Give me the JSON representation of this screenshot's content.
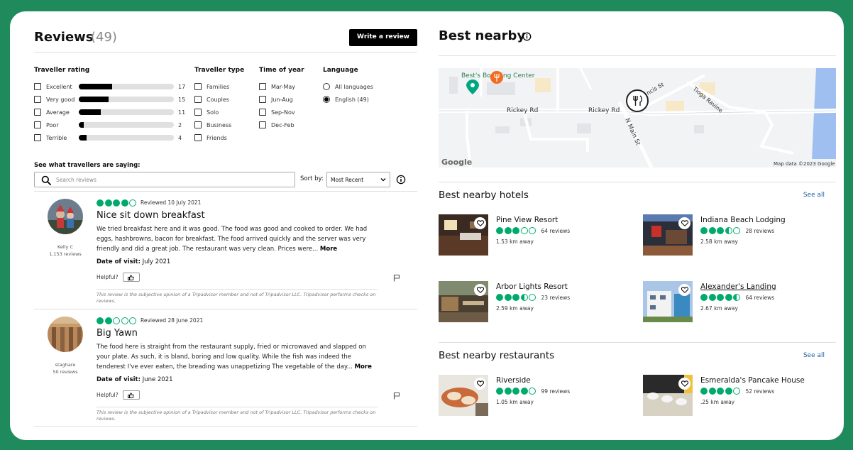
{
  "reviews_header": {
    "title": "Reviews",
    "count": "(49)",
    "write_button": "Write a review"
  },
  "filters": {
    "rating": {
      "heading": "Traveller rating",
      "items": [
        {
          "label": "Excellent",
          "count": "17",
          "fraction": 0.35
        },
        {
          "label": "Very good",
          "count": "15",
          "fraction": 0.31
        },
        {
          "label": "Average",
          "count": "11",
          "fraction": 0.23
        },
        {
          "label": "Poor",
          "count": "2",
          "fraction": 0.05
        },
        {
          "label": "Terrible",
          "count": "4",
          "fraction": 0.08
        }
      ]
    },
    "type": {
      "heading": "Traveller type",
      "items": [
        "Families",
        "Couples",
        "Solo",
        "Business",
        "Friends"
      ]
    },
    "time": {
      "heading": "Time of year",
      "items": [
        "Mar-May",
        "Jun-Aug",
        "Sep-Nov",
        "Dec-Feb"
      ]
    },
    "language": {
      "heading": "Language",
      "items": [
        "All languages",
        "English (49)"
      ],
      "selected": 1
    }
  },
  "search": {
    "heading": "See what travellers are saying:",
    "placeholder": "Search reviews",
    "sort_label": "Sort by:",
    "sort_value": "Most Recent"
  },
  "reviews": [
    {
      "user": "Kelly C",
      "user_reviews": "1,153 reviews",
      "rating": 4,
      "reviewed": "Reviewed 10 July 2021",
      "title": "Nice sit down breakfast",
      "body": "We tried breakfast here and it was good. The food was good and cooked to order. We had eggs, hashbrowns, bacon for breakfast. The food arrived quickly and the server was very friendly and did a great job. The restaurant was very clean. Prices were...",
      "more": "More",
      "visit_label": "Date of visit:",
      "visit_date": "July 2021",
      "helpful": "Helpful?",
      "disclaimer": "This review is the subjective opinion of a Tripadvisor member and not of Tripadvisor LLC. Tripadvisor performs checks on reviews."
    },
    {
      "user": "staghare",
      "user_reviews": "50 reviews",
      "rating": 2,
      "reviewed": "Reviewed 28 June 2021",
      "title": "Big Yawn",
      "body": "The food here is straight from the restaurant supply, fried or microwaved and slapped on your plate. As such, it is bland, boring and low quality. While the fish was indeed the tenderest I've ever eaten, the breading was unappetizing The vegetable of the day...",
      "more": "More",
      "visit_label": "Date of visit:",
      "visit_date": "June 2021",
      "helpful": "Helpful?",
      "disclaimer": "This review is the subjective opinion of a Tripadvisor member and not of Tripadvisor LLC. Tripadvisor performs checks on reviews."
    }
  ],
  "nearby": {
    "title": "Best nearby",
    "map": {
      "place": "Best's Boarding Center",
      "roads": [
        "Rickey Rd",
        "Rickey Rd",
        "N Main St",
        "Tioga Ravine",
        "ncis St"
      ],
      "logo": "Google",
      "attribution": "Map data ©2023 Google"
    },
    "hotels": {
      "title": "Best nearby hotels",
      "see_all": "See all",
      "items": [
        {
          "name": "Pine View Resort",
          "rating": 3,
          "reviews": "64 reviews",
          "distance": "1.53 km away"
        },
        {
          "name": "Indiana Beach Lodging",
          "rating": 3.5,
          "reviews": "28 reviews",
          "distance": "2.58 km away"
        },
        {
          "name": "Arbor Lights Resort",
          "rating": 3.5,
          "reviews": "23 reviews",
          "distance": "2.59 km away"
        },
        {
          "name": "Alexander's Landing",
          "rating": 4.5,
          "reviews": "64 reviews",
          "distance": "2.67 km away"
        }
      ]
    },
    "restaurants": {
      "title": "Best nearby restaurants",
      "see_all": "See all",
      "items": [
        {
          "name": "Riverside",
          "rating": 4,
          "reviews": "99 reviews",
          "distance": "1.05 km away"
        },
        {
          "name": "Esmeralda's Pancake House",
          "rating": 4,
          "reviews": "52 reviews",
          "distance": ".25 km away"
        }
      ]
    }
  },
  "colors": {
    "background": "#1f8a5b",
    "rating_green": "#00aa6c",
    "link_blue": "#1a5fa0",
    "pin_orange": "#f26b21",
    "pin_green": "#00a680"
  }
}
